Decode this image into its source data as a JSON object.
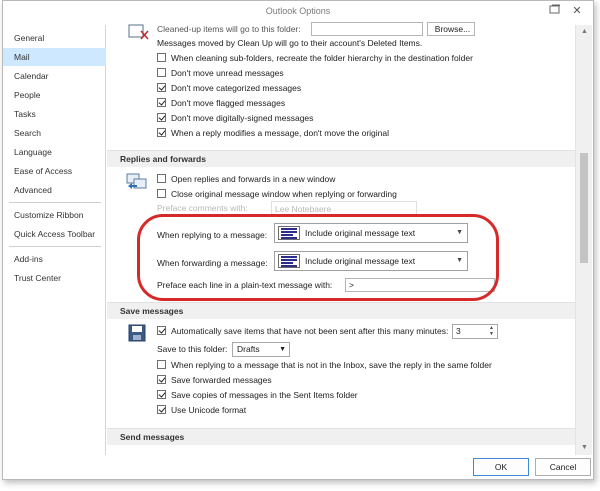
{
  "window": {
    "title": "Outlook Options"
  },
  "sidebar": {
    "items": [
      {
        "label": "General"
      },
      {
        "label": "Mail"
      },
      {
        "label": "Calendar"
      },
      {
        "label": "People"
      },
      {
        "label": "Tasks"
      },
      {
        "label": "Search"
      },
      {
        "label": "Language"
      },
      {
        "label": "Ease of Access"
      },
      {
        "label": "Advanced"
      },
      {
        "label": "Customize Ribbon"
      },
      {
        "label": "Quick Access Toolbar"
      },
      {
        "label": "Add-ins"
      },
      {
        "label": "Trust Center"
      }
    ],
    "active": "Mail"
  },
  "cleanup": {
    "partial_label": "Cleaned-up items will go to this folder:",
    "browse": "Browse...",
    "info": "Messages moved by Clean Up will go to their account's Deleted Items.",
    "options": [
      {
        "label": "When cleaning sub-folders, recreate the folder hierarchy in the destination folder",
        "checked": false
      },
      {
        "label": "Don't move unread messages",
        "checked": false
      },
      {
        "label": "Don't move categorized messages",
        "checked": true
      },
      {
        "label": "Don't move flagged messages",
        "checked": true
      },
      {
        "label": "Don't move digitally-signed messages",
        "checked": true
      },
      {
        "label": "When a reply modifies a message, don't move the original",
        "checked": true
      }
    ]
  },
  "replies": {
    "header": "Replies and forwards",
    "options": [
      {
        "label": "Open replies and forwards in a new window",
        "checked": false
      },
      {
        "label": "Close original message window when replying or forwarding",
        "checked": false
      }
    ],
    "preface_comments_label": "Preface comments with:",
    "preface_comments_value": "Lee Notebaere",
    "reply_label": "When replying to a message:",
    "reply_value": "Include original message text",
    "forward_label": "When forwarding a message:",
    "forward_value": "Include original message text",
    "preface_line_label": "Preface each line in a plain-text message with:",
    "preface_line_value": ">"
  },
  "save": {
    "header": "Save messages",
    "autosave_label": "Automatically save items that have not been sent after this many minutes:",
    "autosave_checked": true,
    "autosave_minutes": "3",
    "folder_label": "Save to this folder:",
    "folder_value": "Drafts",
    "options": [
      {
        "label": "When replying to a message that is not in the Inbox, save the reply in the same folder",
        "checked": false
      },
      {
        "label": "Save forwarded messages",
        "checked": true
      },
      {
        "label": "Save copies of messages in the Sent Items folder",
        "checked": true
      },
      {
        "label": "Use Unicode format",
        "checked": true
      }
    ]
  },
  "send": {
    "header": "Send messages"
  },
  "buttons": {
    "ok": "OK",
    "cancel": "Cancel"
  },
  "colors": {
    "active_nav": "#cde8ff",
    "highlight_ring": "#d62a2a",
    "section_bg": "#f0f0f0"
  }
}
